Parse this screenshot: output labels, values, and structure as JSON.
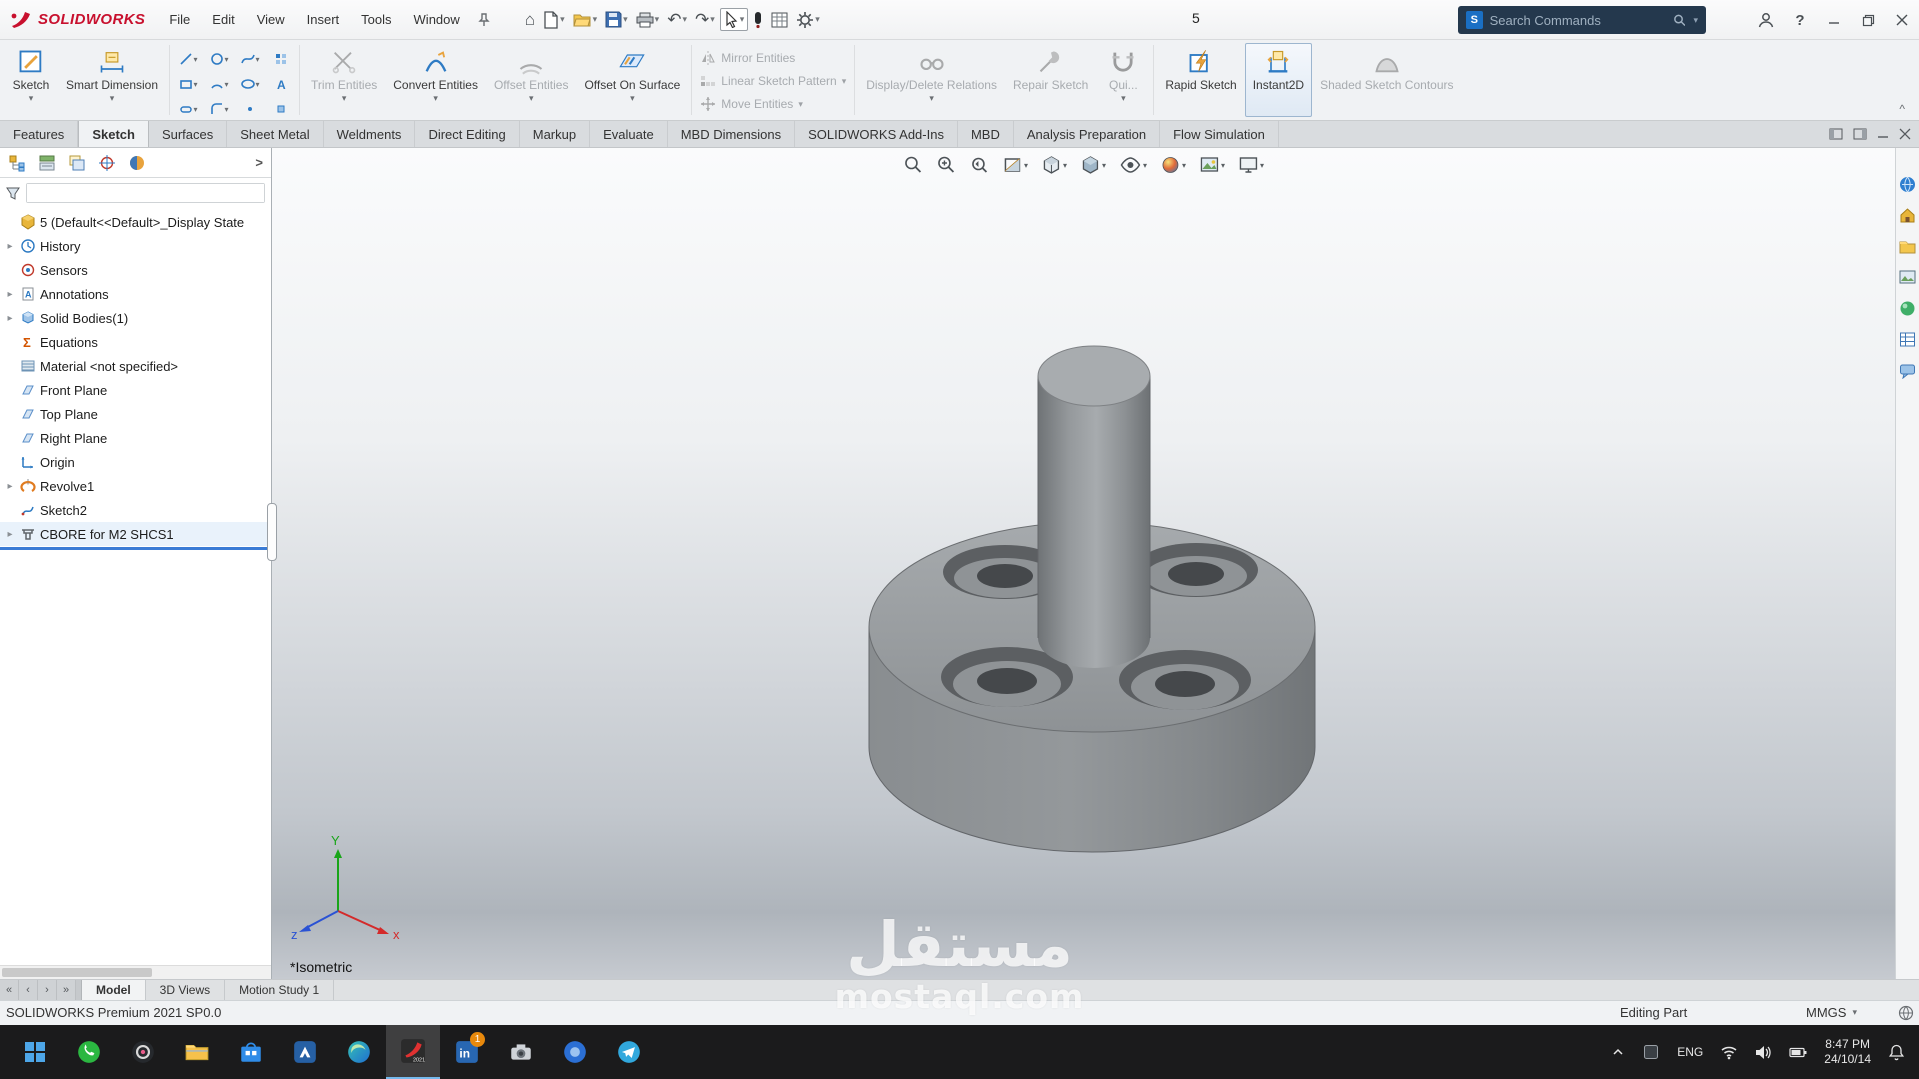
{
  "icons": {
    "caret_down": "▾",
    "caret_up": "^",
    "tree_expand": "▸",
    "panel_chevron": ">",
    "home": "⌂",
    "undo": "↶",
    "redo": "↷",
    "help": "?",
    "nav_first": "«",
    "nav_prev": "‹",
    "nav_next": "›",
    "nav_last": "»"
  },
  "titlebar": {
    "logo_text": "SOLIDWORKS",
    "menus": [
      "File",
      "Edit",
      "View",
      "Insert",
      "Tools",
      "Window"
    ],
    "document_title": "5",
    "search_placeholder": "Search Commands"
  },
  "ribbon": {
    "buttons": {
      "sketch": "Sketch",
      "smart_dimension": "Smart Dimension",
      "trim_entities": "Trim Entities",
      "convert_entities": "Convert Entities",
      "offset_entities": "Offset Entities",
      "offset_on_surface": "Offset On Surface",
      "mirror_entities": "Mirror Entities",
      "linear_sketch_pattern": "Linear Sketch Pattern",
      "move_entities": "Move Entities",
      "display_delete_relations": "Display/Delete Relations",
      "repair_sketch": "Repair Sketch",
      "quick": "Qui...",
      "rapid_sketch": "Rapid Sketch",
      "instant2d": "Instant2D",
      "shaded_sketch_contours": "Shaded Sketch Contours"
    }
  },
  "tabs": {
    "items": [
      "Features",
      "Sketch",
      "Surfaces",
      "Sheet Metal",
      "Weldments",
      "Direct Editing",
      "Markup",
      "Evaluate",
      "MBD Dimensions",
      "SOLIDWORKS Add-Ins",
      "MBD",
      "Analysis Preparation",
      "Flow Simulation"
    ],
    "active": "Sketch"
  },
  "feature_tree": {
    "root": "5 (Default<<Default>_Display State",
    "items": [
      {
        "label": "History"
      },
      {
        "label": "Sensors"
      },
      {
        "label": "Annotations"
      },
      {
        "label": "Solid Bodies(1)"
      },
      {
        "label": "Equations"
      },
      {
        "label": "Material <not specified>"
      },
      {
        "label": "Front Plane"
      },
      {
        "label": "Top Plane"
      },
      {
        "label": "Right Plane"
      },
      {
        "label": "Origin"
      },
      {
        "label": "Revolve1"
      },
      {
        "label": "Sketch2"
      },
      {
        "label": "CBORE for M2 SHCS1",
        "selected": true
      }
    ]
  },
  "viewport": {
    "view_label": "*Isometric",
    "triad": {
      "x": "x",
      "y": "Y",
      "z": "z"
    },
    "headsup_icons": [
      "zoom-to-fit",
      "zoom-to-area",
      "previous-view",
      "section-view",
      "view-orientation",
      "display-style",
      "hide-show-items",
      "edit-appearance",
      "apply-scene",
      "view-settings"
    ],
    "task_pane_icons": [
      "solidworks-resources",
      "design-library",
      "file-explorer",
      "view-palette",
      "appearances-scenes",
      "custom-properties"
    ]
  },
  "doc_tabs": {
    "items": [
      "Model",
      "3D Views",
      "Motion Study 1"
    ],
    "active": "Model"
  },
  "statusbar": {
    "left": "SOLIDWORKS Premium 2021 SP0.0",
    "mode": "Editing Part",
    "units": "MMGS"
  },
  "taskbar": {
    "language": "ENG",
    "time": "8:47 PM",
    "date": "24/10/14",
    "linkedin_badge": "1",
    "apps": [
      "start",
      "whatsapp",
      "app",
      "file-explorer",
      "microsoft-store",
      "app",
      "edge",
      "solidworks",
      "linkedin",
      "screenshot-tool",
      "app",
      "telegram"
    ]
  },
  "watermark": {
    "title": "مستقل",
    "url": "mostaql.com"
  }
}
